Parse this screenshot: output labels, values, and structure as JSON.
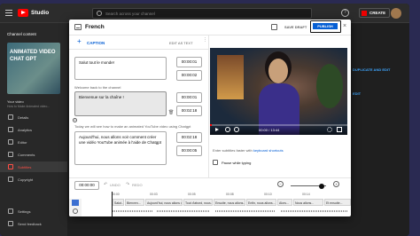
{
  "studio": {
    "logo_text": "Studio",
    "search_placeholder": "Search across your channel",
    "help_label": "?",
    "create_label": "CREATE"
  },
  "sidebar": {
    "channel_content_label": "Channel content",
    "thumbnail_lines": [
      "ANIMATED VIDEO",
      "CHAT GPT"
    ],
    "your_video_label": "Your video",
    "video_subtitle": "How to Make Animated video...",
    "items": [
      {
        "label": "Details",
        "icon": "pencil-icon"
      },
      {
        "label": "Analytics",
        "icon": "analytics-icon"
      },
      {
        "label": "Editor",
        "icon": "editor-icon"
      },
      {
        "label": "Comments",
        "icon": "comments-icon"
      },
      {
        "label": "Subtitles",
        "icon": "subtitles-icon",
        "active": true
      },
      {
        "label": "Copyright",
        "icon": "copyright-icon"
      }
    ],
    "bottom_items": [
      {
        "label": "Settings",
        "icon": "gear-icon"
      },
      {
        "label": "Send feedback",
        "icon": "feedback-icon"
      }
    ]
  },
  "background_right": {
    "duplicate_label": "DUPLICATE AND EDIT",
    "edit_label": "EDIT"
  },
  "dialog": {
    "title": "French",
    "save_draft_label": "SAVE DRAFT",
    "publish_label": "PUBLISH",
    "close_label": "×",
    "caption_bar": {
      "add_caption_label": "CAPTION",
      "edit_as_text_label": "EDIT AS TEXT",
      "more_label": "⋮"
    },
    "captions": [
      {
        "text": "Salut tout le monde!",
        "start": "00:00:01",
        "end": "00:00:02"
      },
      {
        "text": "Bienvenue sur la chaîne !",
        "start": "00:00:01",
        "end": "00:02:18",
        "hint": "Welcome back to the channel",
        "selected": true
      },
      {
        "text": "Aujourd'hui, nous allons voir comment créer une vidéo YouTube animée à l'aide de Chatgpt",
        "start": "00:02:18",
        "end": "00:00:05",
        "hint": "Today we will see how to make an animated YouTube video using Chatgpt"
      }
    ],
    "video": {
      "time_display": "00:00 / 13:44",
      "progress": 0.01,
      "shortcut_text": "Enter subtitles faster with",
      "shortcut_link": "keyboard shortcuts",
      "pause_label": "Pause while typing"
    },
    "timeline": {
      "current_time": "00:00:00",
      "undo_label": "UNDO",
      "redo_label": "REDO",
      "ticks": [
        "00:00",
        "00:03",
        "00:05",
        "00:08",
        "00:10",
        "00:14"
      ],
      "segments": [
        "Salut...",
        "Bienven...",
        "Aujourd'hui, nous allons voir...",
        "Tout d'abord, nous allons...",
        "Ensuite, nous allons...",
        "Enfin, nous allons...",
        "Alors...",
        "Nous allons...",
        "Et ensuite..."
      ]
    }
  }
}
